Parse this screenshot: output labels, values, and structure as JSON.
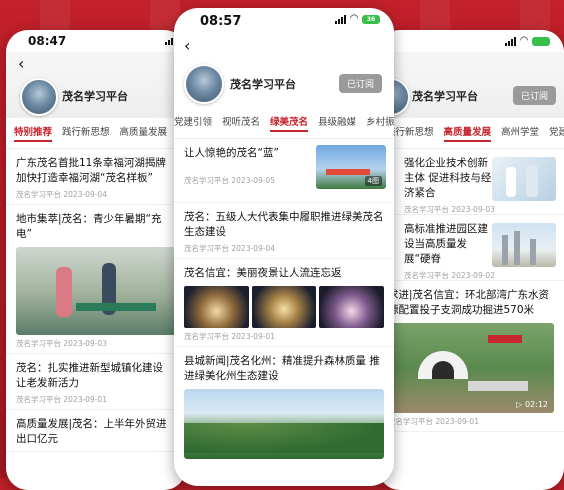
{
  "left": {
    "time": "08:47",
    "profile_name": "茂名学习平台",
    "tabs": [
      "特别推荐",
      "践行新思想",
      "高质量发展"
    ],
    "articles": [
      {
        "title": "广东茂名首批11条幸福河湖揭牌 加快打造幸福河湖“茂名样板”",
        "meta": "茂名学习平台 2023-09-04"
      },
      {
        "title": "地市集萃|茂名：青少年暑期“充电”",
        "meta": "茂名学习平台 2023-09-03"
      },
      {
        "title": "茂名：扎实推进新型城镇化建设 让老发新活力",
        "meta": "茂名学习平台 2023-09-01"
      },
      {
        "title": "高质量发展|茂名：上半年外贸进出口亿元",
        "meta": ""
      }
    ]
  },
  "center": {
    "time": "08:57",
    "battery": "36",
    "profile_name": "茂名学习平台",
    "follow_label": "已订阅",
    "tabs": [
      "党建引领",
      "视听茂名",
      "绿美茂名",
      "县级融媒",
      "乡村振"
    ],
    "active_tab": "绿美茂名",
    "articles": [
      {
        "title": "让人惊艳的茂名“蓝”",
        "meta": "茂名学习平台 2023-09-05",
        "badge": "4图"
      },
      {
        "title": "茂名：五级人大代表集中履职推进绿美茂名生态建设",
        "meta": "茂名学习平台 2023-09-04"
      },
      {
        "title": "茂名信宜：美丽夜景让人流连忘返",
        "meta": "茂名学习平台 2023-09-01"
      },
      {
        "title": "县城新闻|茂名化州：精准提升森林质量 推进绿美化州生态建设",
        "meta": ""
      }
    ]
  },
  "right": {
    "profile_name": "茂名学习平台",
    "follow_label": "已订阅",
    "tabs": [
      "践行新思想",
      "高质量发展",
      "高州学堂",
      "党建"
    ],
    "active_tab": "高质量发展",
    "articles": [
      {
        "title": "强化企业技术创新主体 促进科技与经济紧合",
        "meta": "茂名学习平台 2023-09-03"
      },
      {
        "title": "高标准推进园区建设当高质量发展“硬脊",
        "meta": "茂名学习平台 2023-09-02"
      },
      {
        "title": "求进|茂名信宜：环北部湾广东水资源配置投子支洞成功掘进570米",
        "meta": "茂名学习平台 2023-09-01",
        "video_time": "02:12"
      }
    ]
  }
}
